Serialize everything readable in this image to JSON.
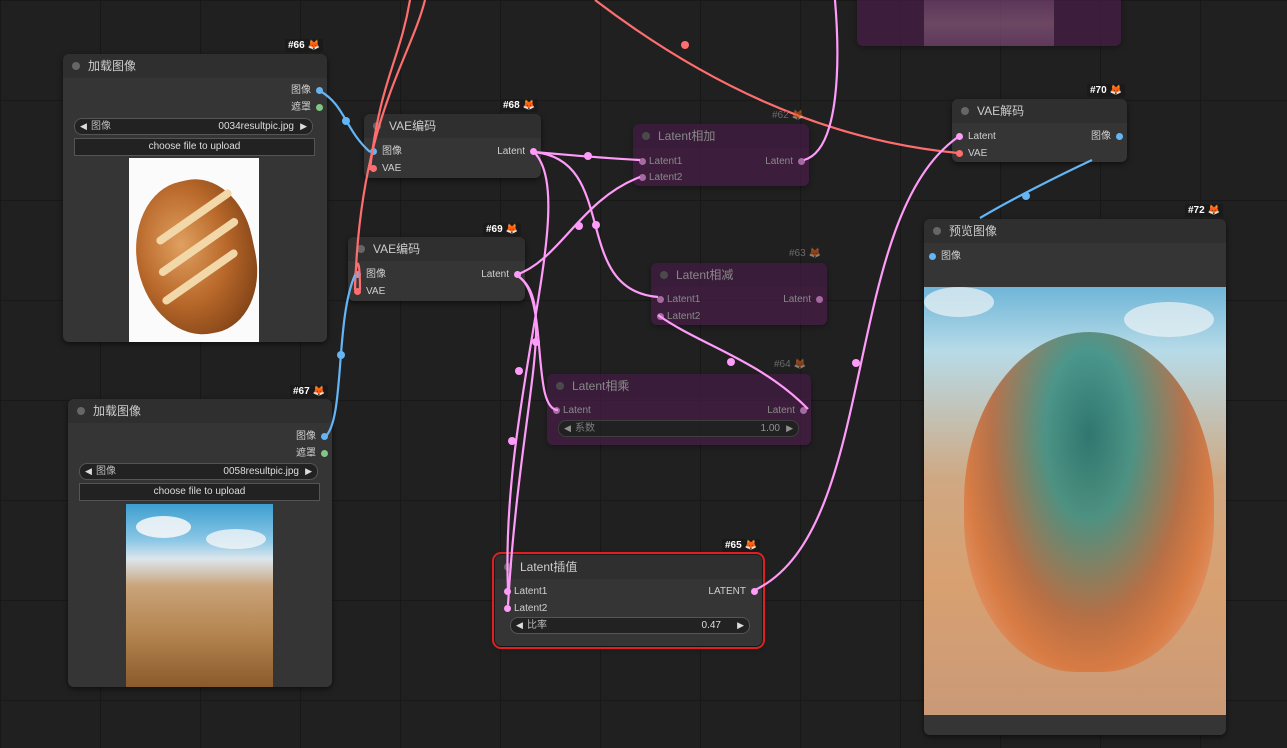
{
  "nodes": {
    "load66": {
      "id": "#66",
      "title": "加载图像",
      "out_image": "图像",
      "out_mask": "遮罩",
      "combo_label": "图像",
      "combo_value": "0034resultpic.jpg",
      "upload": "choose file to upload"
    },
    "load67": {
      "id": "#67",
      "title": "加载图像",
      "out_image": "图像",
      "out_mask": "遮罩",
      "combo_label": "图像",
      "combo_value": "0058resultpic.jpg",
      "upload": "choose file to upload"
    },
    "vae68": {
      "id": "#68",
      "title": "VAE编码",
      "in_image": "图像",
      "in_vae": "VAE",
      "out_latent": "Latent"
    },
    "vae69": {
      "id": "#69",
      "title": "VAE编码",
      "in_image": "图像",
      "in_vae": "VAE",
      "out_latent": "Latent"
    },
    "add62": {
      "id": "#62",
      "title": "Latent相加",
      "in1": "Latent1",
      "in2": "Latent2",
      "out": "Latent"
    },
    "sub63": {
      "id": "#63",
      "title": "Latent相减",
      "in1": "Latent1",
      "in2": "Latent2",
      "out": "Latent"
    },
    "mul64": {
      "id": "#64",
      "title": "Latent相乘",
      "in": "Latent",
      "out": "Latent",
      "combo_label": "系数",
      "combo_value": "1.00"
    },
    "interp65": {
      "id": "#65",
      "title": "Latent插值",
      "in1": "Latent1",
      "in2": "Latent2",
      "out": "LATENT",
      "combo_label": "比率",
      "combo_value": "0.47"
    },
    "decode70": {
      "id": "#70",
      "title": "VAE解码",
      "in_latent": "Latent",
      "in_vae": "VAE",
      "out_image": "图像"
    },
    "preview72": {
      "id": "#72",
      "title": "预览图像",
      "in_image": "图像"
    }
  },
  "colors": {
    "canvas": "#202020",
    "node": "#353535",
    "bypass": "#4f1d4f",
    "wire_latent": "#ff9cf9",
    "wire_vae": "#ff6e6e",
    "wire_image": "#64b5f6",
    "selected_outline": "#e02020",
    "badge_fox": "#f08a24"
  },
  "icons": {
    "fox": "fox-icon",
    "arrow_left": "arrow-left-icon",
    "arrow_right": "arrow-right-icon"
  }
}
